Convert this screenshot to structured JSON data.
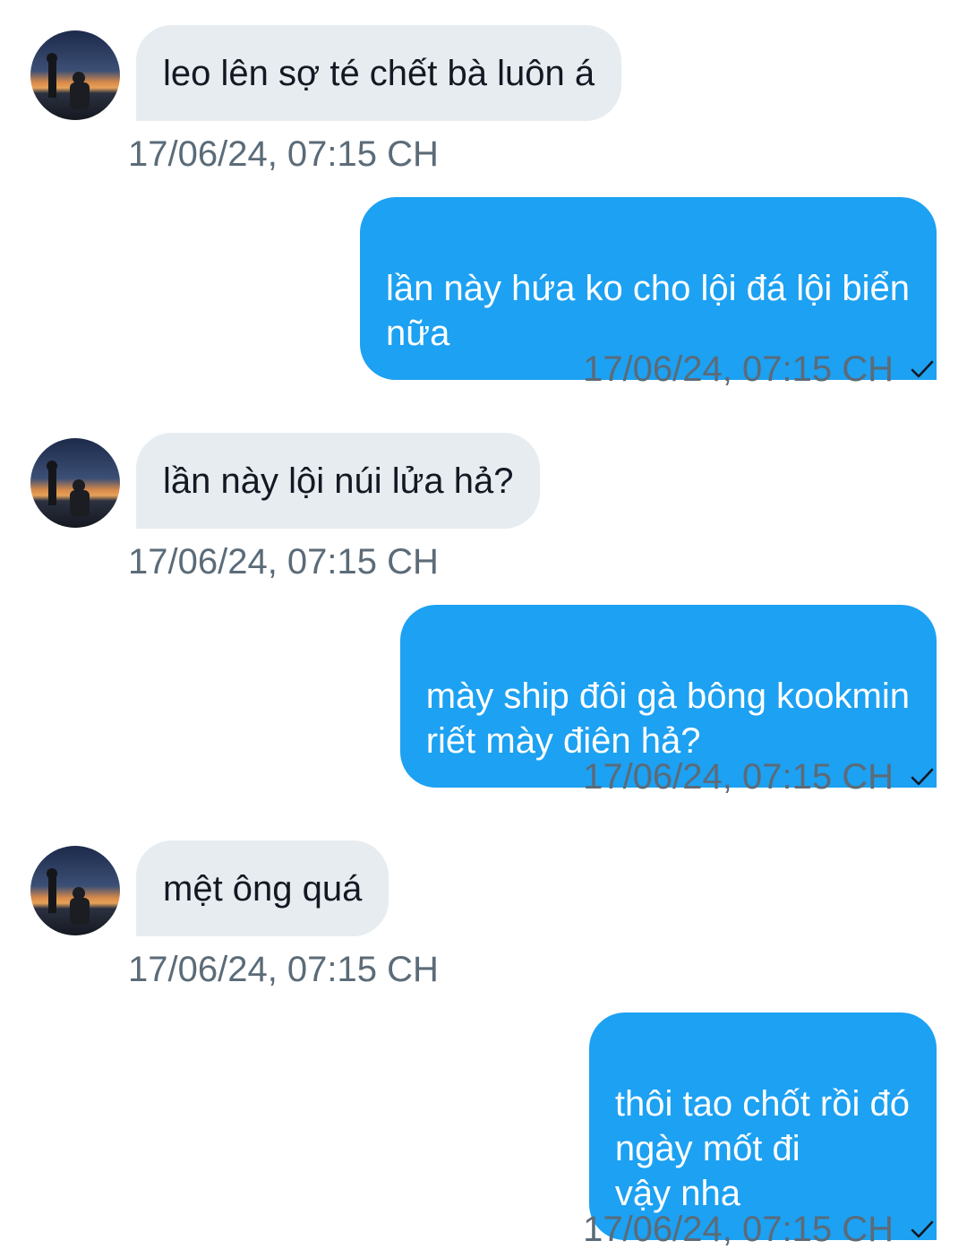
{
  "messages": [
    {
      "side": "in",
      "text": "leo lên sợ té chết bà luôn á",
      "time": "17/06/24, 07:15 CH"
    },
    {
      "side": "out",
      "text": "lần này hứa ko cho lội đá lội biển\nnữa",
      "time": "17/06/24, 07:15 CH",
      "status": "sent-check-icon"
    },
    {
      "side": "in",
      "text": "lần này lội núi lửa hả?",
      "time": "17/06/24, 07:15 CH"
    },
    {
      "side": "out",
      "text": "mày ship đôi gà bông kookmin\nriết mày điên hả?",
      "time": "17/06/24, 07:15 CH",
      "status": "sent-check-icon"
    },
    {
      "side": "in",
      "text": "mệt ông quá",
      "time": "17/06/24, 07:15 CH"
    },
    {
      "side": "out",
      "text": "thôi tao chốt rồi đó\nngày mốt đi\nvậy nha",
      "time": "17/06/24, 07:15 CH",
      "status": "sent-check-icon"
    }
  ],
  "colors": {
    "incoming_bubble": "#e6ecf0",
    "outgoing_bubble": "#1da1f2",
    "timestamp": "#5b6b78"
  }
}
